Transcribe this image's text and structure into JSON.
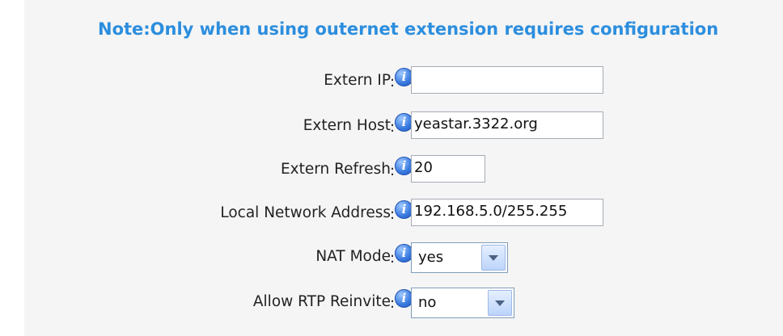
{
  "note": "Note:Only when using outernet extension requires configuration",
  "fields": {
    "extern_ip": {
      "label": "Extern IP",
      "value": ""
    },
    "extern_host": {
      "label": "Extern Host",
      "value": "yeastar.3322.org"
    },
    "extern_refresh": {
      "label": "Extern Refresh",
      "value": "20"
    },
    "local_network": {
      "label": "Local Network Address",
      "value": "192.168.5.0/255.255"
    },
    "nat_mode": {
      "label": "NAT Mode",
      "value": "yes"
    },
    "allow_rtp_reinvite": {
      "label": "Allow RTP Reinvite",
      "value": "no"
    }
  },
  "colon": ":",
  "icons": {
    "info": "info-icon"
  },
  "colors": {
    "note": "#2c8ede",
    "panel": "#f5f5f5"
  }
}
